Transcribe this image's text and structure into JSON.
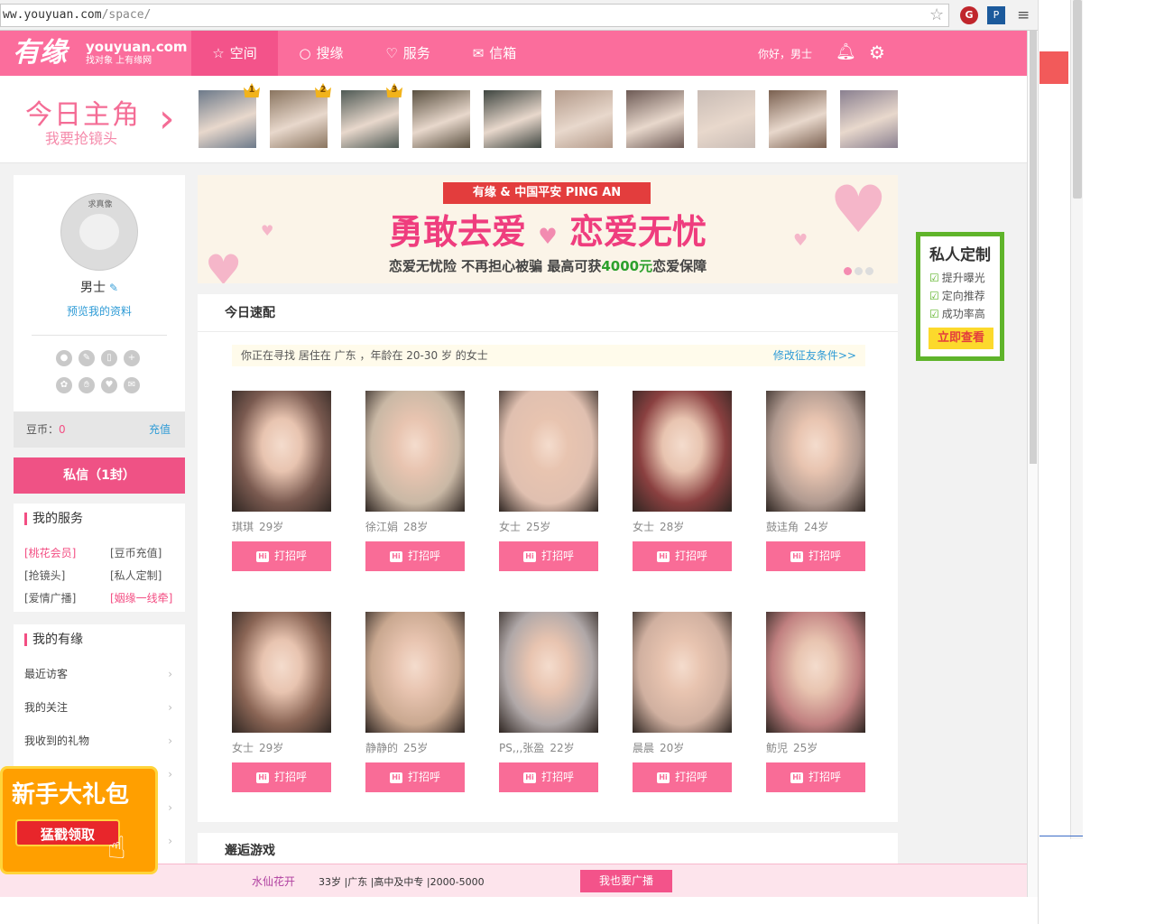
{
  "browser": {
    "url_main": "ww.youyuan.com",
    "url_path": "/space/"
  },
  "header": {
    "logo": "有缘",
    "logo_domain": "youyuan.com",
    "logo_slogan": "找对象 上有缘网",
    "nav": [
      {
        "label": "空间",
        "icon": "star-icon"
      },
      {
        "label": "搜缘",
        "icon": "search-icon"
      },
      {
        "label": "服务",
        "icon": "heart-icon"
      },
      {
        "label": "信箱",
        "icon": "mail-icon"
      }
    ],
    "greeting": "你好，男士"
  },
  "strip": {
    "title": "今日主角",
    "subtitle": "我要抢镜头",
    "ranks": [
      "1",
      "2",
      "3"
    ],
    "photo_colors": [
      "#6d7a8a",
      "#8a7560",
      "#4f5a55",
      "#5a5040",
      "#3e4540",
      "#b39a8a",
      "#6d5a55",
      "#c9bcb5",
      "#7a6050",
      "#8a8090"
    ]
  },
  "profile": {
    "avatar_text": "求真像",
    "name": "男士",
    "preview_link": "预览我的资料",
    "coins_label": "豆币：",
    "coins_value": "0",
    "recharge": "充值",
    "pm_button": "私信（1封）"
  },
  "services": {
    "title": "我的服务",
    "items": [
      {
        "label": "[桃花会员]",
        "pink": true
      },
      {
        "label": "[豆币充值]",
        "pink": false
      },
      {
        "label": "[抢镜头]",
        "pink": false
      },
      {
        "label": "[私人定制]",
        "pink": false
      },
      {
        "label": "[爱情广播]",
        "pink": false
      },
      {
        "label": "[姻缘一线牵]",
        "pink": true
      }
    ]
  },
  "myyouyuan": {
    "title": "我的有缘",
    "items": [
      "最近访客",
      "我的关注",
      "我收到的礼物"
    ]
  },
  "banner": {
    "ribbon": "有缘 & 中国平安 PING AN",
    "main_left": "勇敢去爱",
    "main_right": "恋爱无忧",
    "sub_a": "恋爱无忧险 不再担心被骗 最高可获",
    "sub_amount": "4000元",
    "sub_b": "恋爱保障"
  },
  "match": {
    "title": "今日速配",
    "condition": "你正在寻找 居住在 广东 ，年龄在 20-30 岁 的女士",
    "edit_condition": "修改征友条件>>",
    "greet_label": "打招呼",
    "people": [
      {
        "name": "琪琪",
        "age": "29岁",
        "color": "#7a5a50"
      },
      {
        "name": "徐江娟",
        "age": "28岁",
        "color": "#c9b8a5"
      },
      {
        "name": "女士",
        "age": "25岁",
        "color": "#e0c0b0"
      },
      {
        "name": "女士",
        "age": "28岁",
        "color": "#8a4040"
      },
      {
        "name": "鼓迬角",
        "age": "24岁",
        "color": "#b09a90"
      },
      {
        "name": "女士",
        "age": "29岁",
        "color": "#8a6555"
      },
      {
        "name": "静静的",
        "age": "25岁",
        "color": "#c9a890"
      },
      {
        "name": "PS,,,张盈",
        "age": "22岁",
        "color": "#b0a8a8"
      },
      {
        "name": "晨晨",
        "age": "20岁",
        "color": "#d0b0a0"
      },
      {
        "name": "鲂児",
        "age": "25岁",
        "color": "#c08080"
      }
    ]
  },
  "games": {
    "title": "邂逅游戏"
  },
  "custom": {
    "title": "私人定制",
    "items": [
      "提升曝光",
      "定向推荐",
      "成功率高"
    ],
    "button": "立即查看"
  },
  "bottom": {
    "name": "水仙花开",
    "info": "33岁 |广东 |高中及中专 |2000-5000",
    "button": "我也要广播"
  },
  "gift": {
    "title": "新手大礼包",
    "button": "猛戳领取"
  }
}
